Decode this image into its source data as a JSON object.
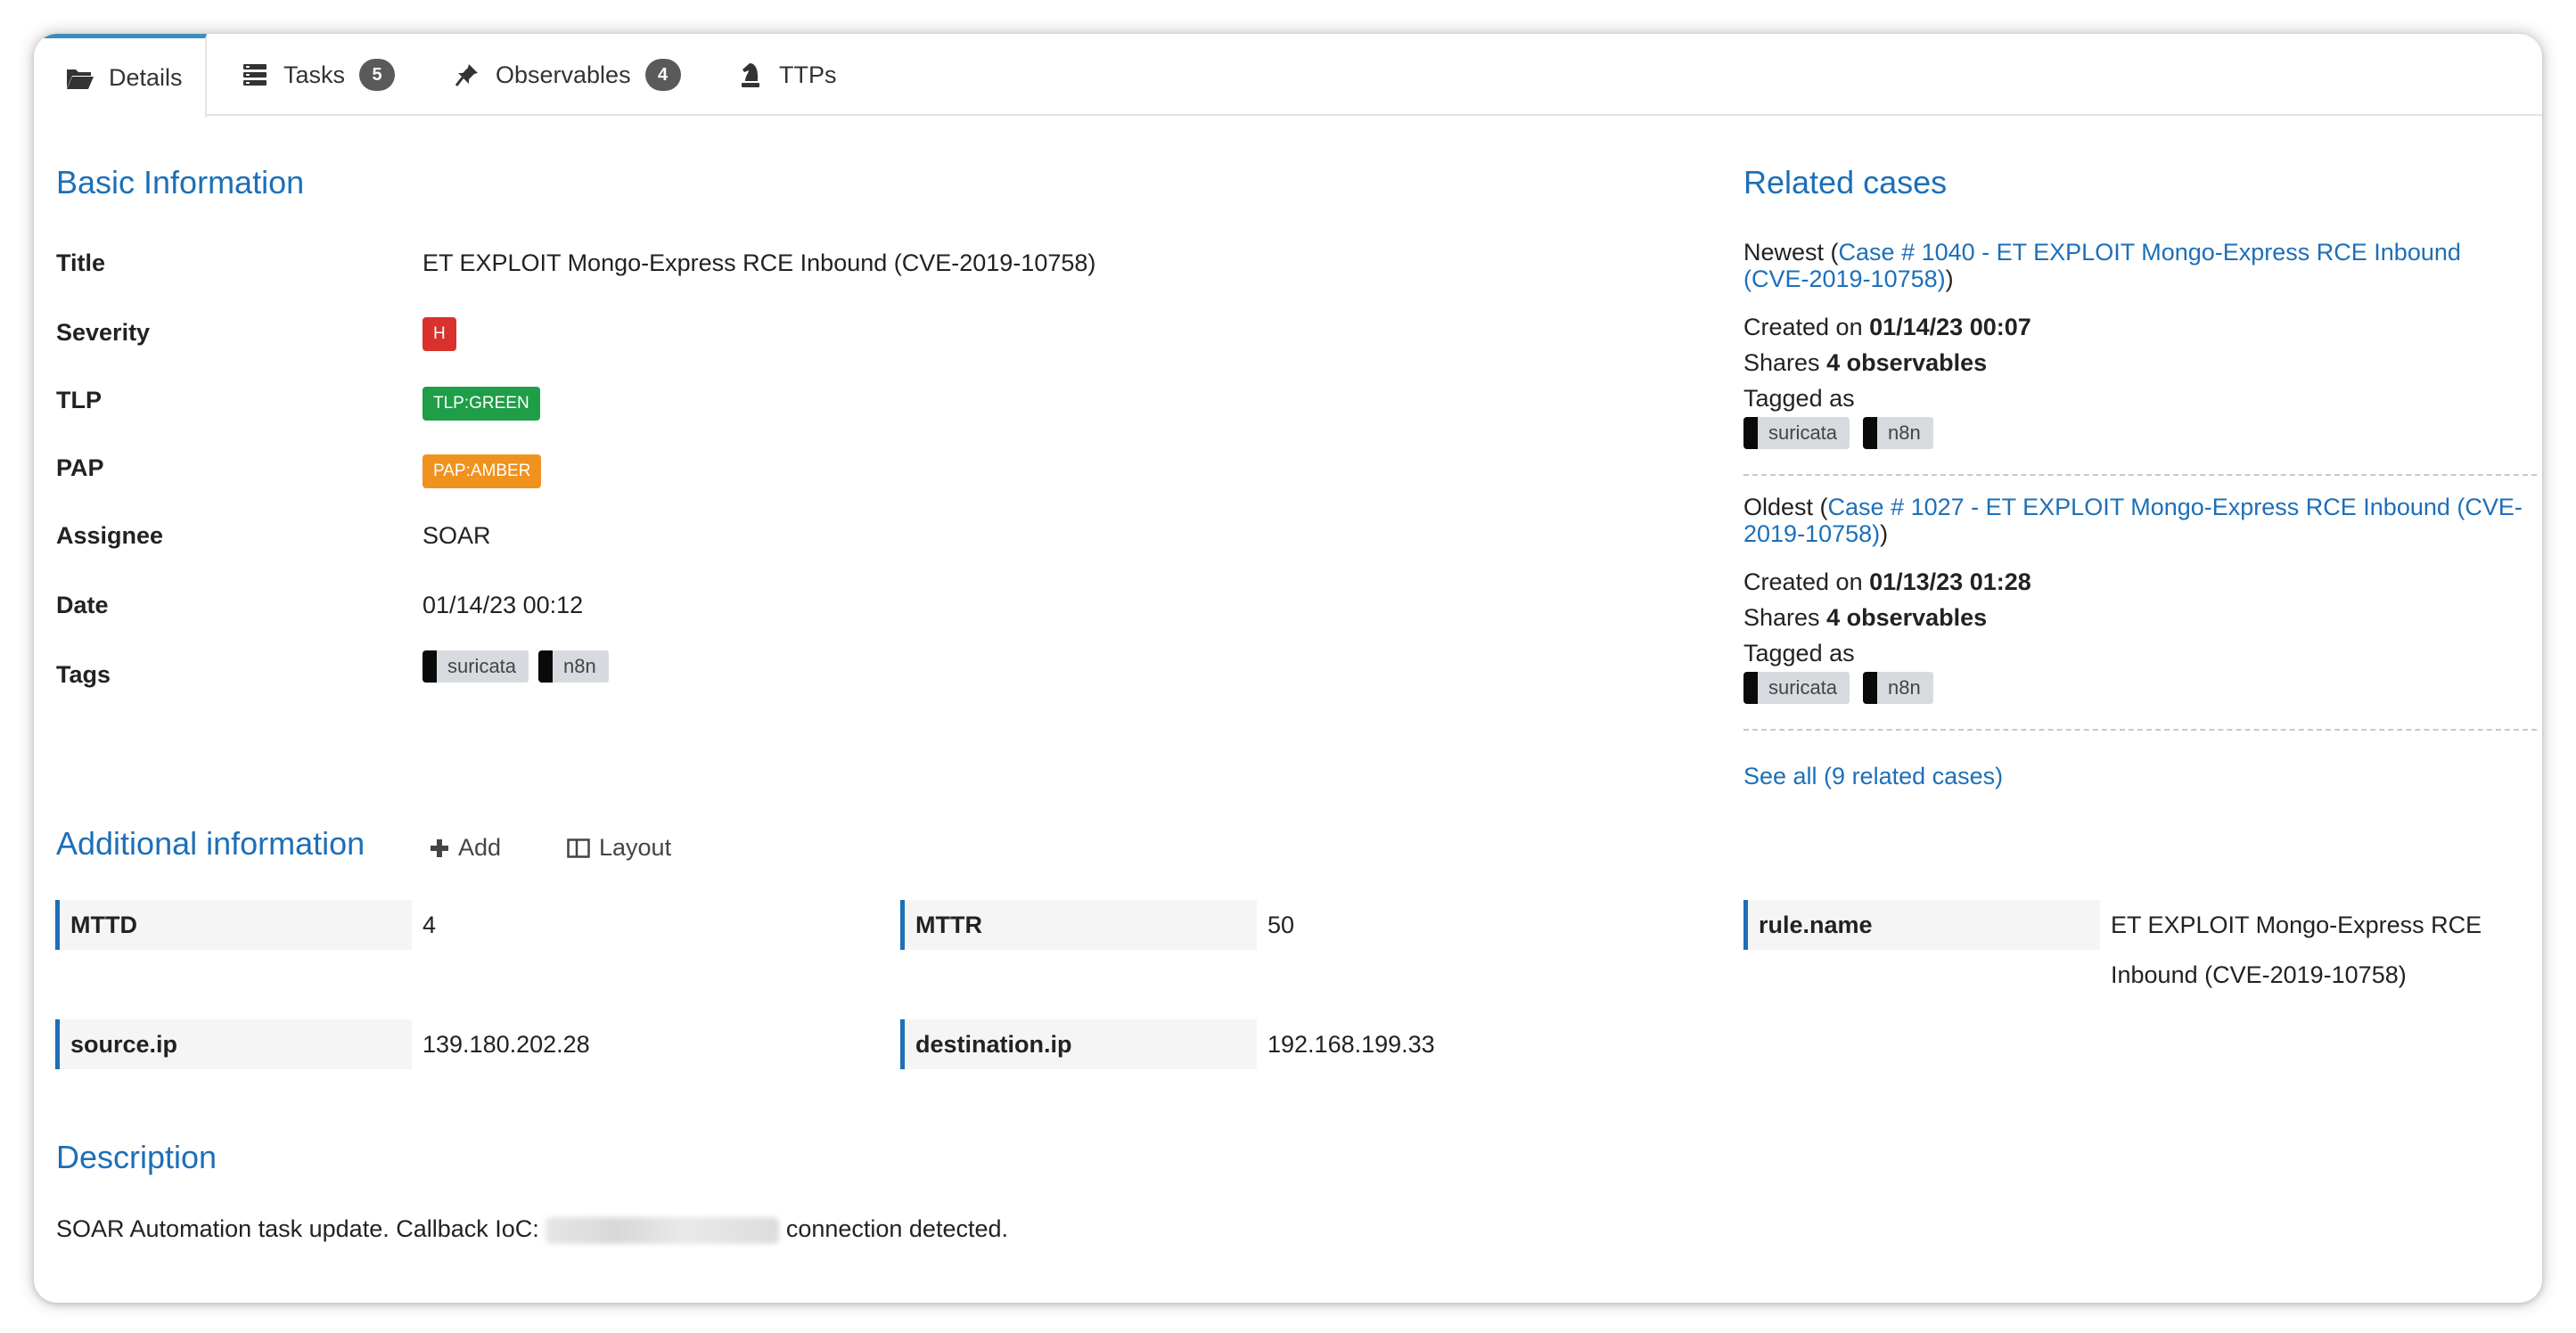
{
  "tabs": [
    {
      "label": "Details",
      "icon": "folder-open-icon"
    },
    {
      "label": "Tasks",
      "icon": "tasks-icon",
      "count": "5"
    },
    {
      "label": "Observables",
      "icon": "pin-icon",
      "count": "4"
    },
    {
      "label": "TTPs",
      "icon": "chess-knight-icon"
    }
  ],
  "basic": {
    "heading": "Basic Information",
    "title_label": "Title",
    "title_value": "ET EXPLOIT Mongo-Express RCE Inbound (CVE-2019-10758)",
    "severity_label": "Severity",
    "severity_value": "H",
    "tlp_label": "TLP",
    "tlp_value": "TLP:GREEN",
    "pap_label": "PAP",
    "pap_value": "PAP:AMBER",
    "assignee_label": "Assignee",
    "assignee_value": "SOAR",
    "date_label": "Date",
    "date_value": "01/14/23 00:12",
    "tags_label": "Tags",
    "tags": [
      "suricata",
      "n8n"
    ]
  },
  "related": {
    "heading": "Related cases",
    "newest": {
      "prefix": "Newest (",
      "link": "Case # 1040 - ET EXPLOIT Mongo-Express RCE Inbound (CVE-2019-10758)",
      "suffix": ")",
      "created_prefix": "Created on ",
      "created": "01/14/23 00:07",
      "shares_prefix": "Shares ",
      "shares": "4 observables",
      "tagged_label": "Tagged as",
      "tags": [
        "suricata",
        "n8n"
      ]
    },
    "oldest": {
      "prefix": "Oldest (",
      "link": "Case # 1027 - ET EXPLOIT Mongo-Express RCE Inbound (CVE-2019-10758)",
      "suffix": ")",
      "created_prefix": "Created on ",
      "created": "01/13/23 01:28",
      "shares_prefix": "Shares ",
      "shares": "4 observables",
      "tagged_label": "Tagged as",
      "tags": [
        "suricata",
        "n8n"
      ]
    },
    "see_all": "See all (9 related cases)"
  },
  "additional": {
    "heading": "Additional information",
    "add_label": "Add",
    "layout_label": "Layout",
    "fields": {
      "mttd": {
        "key": "MTTD",
        "value": "4"
      },
      "mttr": {
        "key": "MTTR",
        "value": "50"
      },
      "rule_name": {
        "key": "rule.name",
        "value_line1": "ET EXPLOIT Mongo-Express RCE",
        "value_line2": "Inbound (CVE-2019-10758)"
      },
      "source_ip": {
        "key": "source.ip",
        "value": "139.180.202.28"
      },
      "destination_ip": {
        "key": "destination.ip",
        "value": "192.168.199.33"
      }
    }
  },
  "description": {
    "heading": "Description",
    "text_before": "SOAR Automation task update. Callback IoC:",
    "text_after": "connection detected."
  },
  "colors": {
    "accent": "#1d6fb8",
    "severity_high": "#d9312b",
    "tlp_green": "#1f9e48",
    "pap_amber": "#f0921e",
    "badge": "#5a5a5a"
  }
}
